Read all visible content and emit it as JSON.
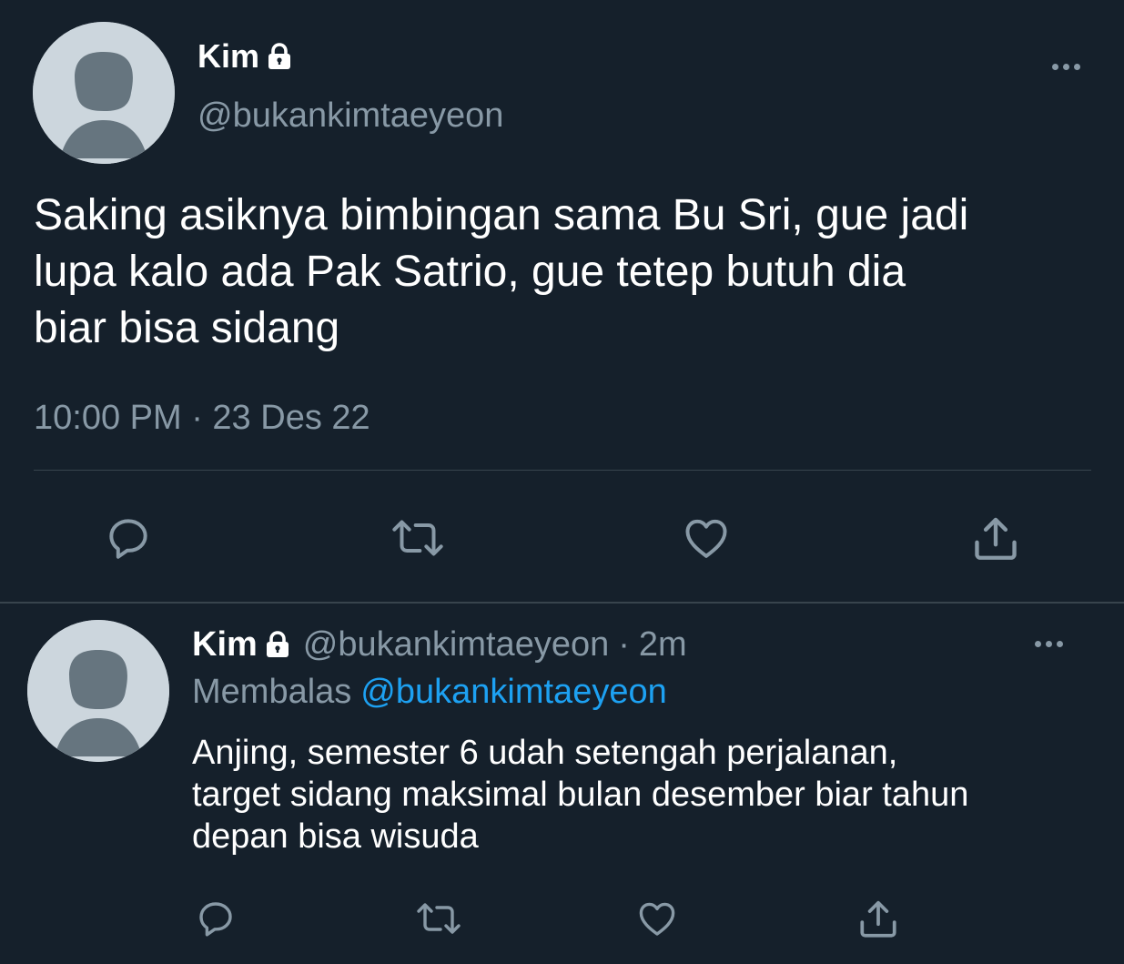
{
  "colors": {
    "background": "#15202b",
    "primary_text": "#ffffff",
    "secondary_text": "#8899a6",
    "accent": "#1da1f2",
    "divider": "#38444d",
    "avatar_bg": "#ccd6dd",
    "avatar_figure": "#66757f"
  },
  "main_tweet": {
    "author_name": "Kim",
    "lock_icon": "lock-icon",
    "handle": "@bukankimtaeyeon",
    "text": "Saking asiknya bimbingan sama Bu Sri, gue jadi\nlupa kalo ada Pak Satrio, gue tetep butuh dia\nbiar bisa sidang",
    "timestamp": "10:00 PM · 23 Des 22",
    "actions": [
      "reply-icon",
      "retweet-icon",
      "like-icon",
      "share-icon"
    ]
  },
  "reply_tweet": {
    "author_name": "Kim",
    "lock_icon": "lock-icon",
    "handle": "@bukankimtaeyeon",
    "separator": "·",
    "time": "2m",
    "replying_label": "Membalas",
    "replying_to": "@bukankimtaeyeon",
    "text": "Anjing, semester 6 udah setengah perjalanan,\ntarget sidang maksimal bulan desember biar tahun\ndepan bisa wisuda",
    "actions": [
      "reply-icon",
      "retweet-icon",
      "like-icon",
      "share-icon"
    ]
  }
}
